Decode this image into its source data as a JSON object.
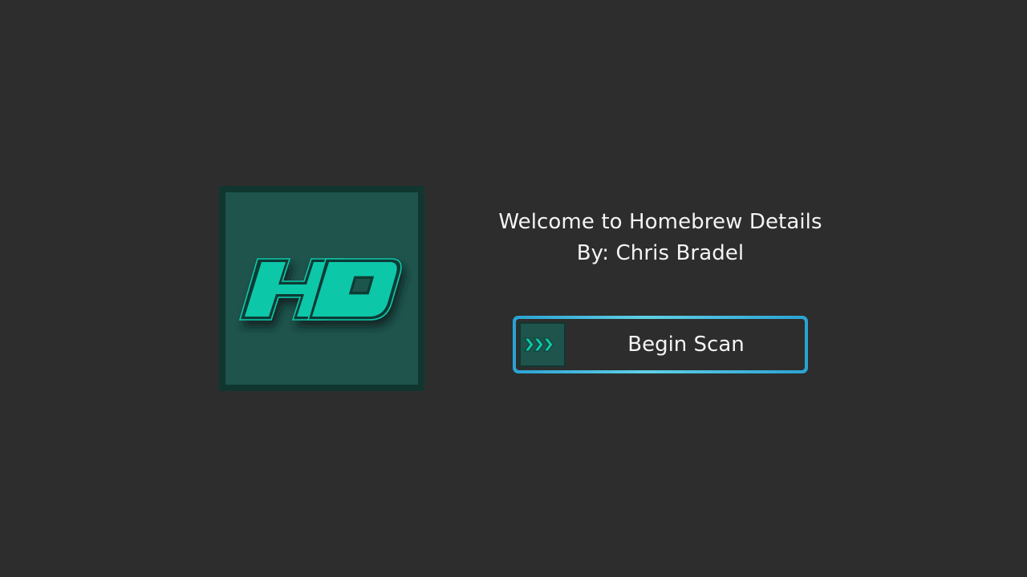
{
  "app": {
    "logo_text": "HD",
    "logo_icon": "hd-logo-icon",
    "accent_color": "#0fc7a9",
    "tile_color": "#1e544c",
    "tile_border_color": "#113630",
    "background_color": "#2d2d2d"
  },
  "welcome": {
    "title": "Welcome to Homebrew Details",
    "author": "By: Chris Bradel"
  },
  "scan_button": {
    "label": "Begin Scan",
    "icon": "triple-chevron-right-icon",
    "border_color": "#2aa2d3"
  }
}
